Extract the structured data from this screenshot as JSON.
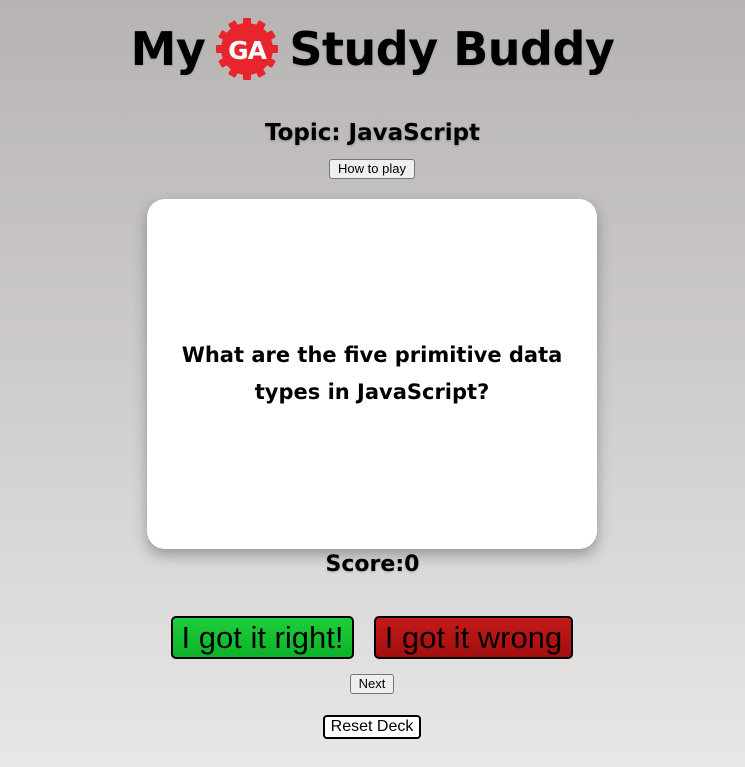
{
  "header": {
    "title_before": "My",
    "logo_text": "GA",
    "title_after": "Study Buddy",
    "logo_color": "#e8252d"
  },
  "topic": {
    "label": "Topic: JavaScript"
  },
  "controls": {
    "how_to_play": "How to play",
    "next": "Next",
    "reset": "Reset Deck",
    "right": "I got it right!",
    "wrong": "I got it wrong"
  },
  "card": {
    "question": "What are the five primitive data types in JavaScript?"
  },
  "score": {
    "label": "Score:",
    "value": "0"
  },
  "colors": {
    "right_button": "#12c232",
    "wrong_button": "#b51515"
  }
}
